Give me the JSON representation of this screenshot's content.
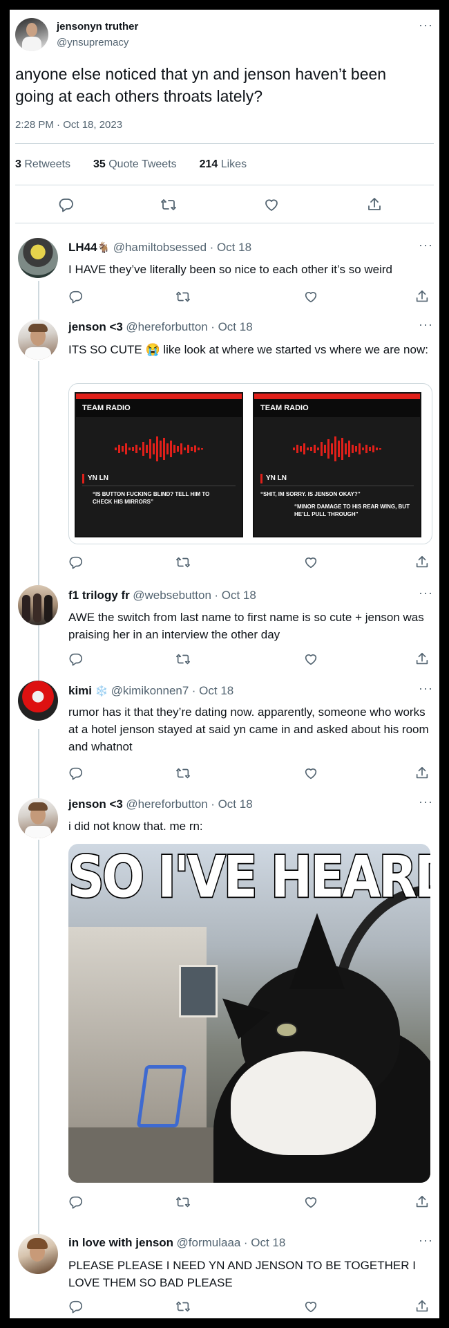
{
  "main_tweet": {
    "display_name": "jensonyn truther",
    "handle": "@ynsupremacy",
    "text": "anyone else noticed that yn and jenson haven’t been going at each others throats lately?",
    "timestamp": "2:28 PM · Oct 18, 2023",
    "stats": [
      {
        "count": "3",
        "label": "Retweets"
      },
      {
        "count": "35",
        "label": "Quote Tweets"
      },
      {
        "count": "214",
        "label": "Likes"
      }
    ]
  },
  "replies": [
    {
      "display_name": "LH44",
      "emoji": "🐐",
      "handle": "@hamiltobsessed",
      "date": "· Oct 18",
      "text": "I HAVE they’ve literally been so nice to each other it’s so weird"
    },
    {
      "display_name": "jenson <3",
      "handle": "@hereforbutton",
      "date": "· Oct 18",
      "text": "ITS SO CUTE 😭 like look at where we started vs where we are now:",
      "media": [
        {
          "header": "TEAM RADIO",
          "speaker": "YN LN",
          "quote": "“IS BUTTON FUCKING BLIND? TELL HIM TO CHECK HIS MIRRORS”",
          "reply": ""
        },
        {
          "header": "TEAM RADIO",
          "speaker": "YN LN",
          "quote": "“SHIT, IM SORRY. IS JENSON OKAY?”",
          "reply": "“MINOR DAMAGE TO HIS REAR WING, BUT HE’LL PULL THROUGH”"
        }
      ]
    },
    {
      "display_name": "f1 trilogy fr",
      "handle": "@websebutton",
      "date": "· Oct 18",
      "text": "AWE the switch from last name to first name is so cute + jenson was praising her in an interview the other day"
    },
    {
      "display_name": "kimi",
      "emoji": "❄️",
      "handle": "@kimikonnen7",
      "date": "· Oct 18",
      "text": "rumor has it that they’re dating now. apparently, someone who works at a hotel jenson stayed at said yn came in and asked about his room and whatnot"
    },
    {
      "display_name": "jenson <3",
      "handle": "@hereforbutton",
      "date": "· Oct 18",
      "text": "i did not know that. me rn:",
      "meme_caption": "SO I'VE HEARD"
    },
    {
      "display_name": "in love with jenson",
      "handle": "@formulaaa",
      "date": "· Oct 18",
      "text": "PLEASE PLEASE I NEED YN AND JENSON TO BE TOGETHER I LOVE THEM SO BAD PLEASE"
    }
  ],
  "more_glyph": "···",
  "colors": {
    "text": "#0f1419",
    "secondary": "#536471",
    "divider": "#cfd9de",
    "radio_red": "#e0201a",
    "radio_bg": "#1a1a1a"
  },
  "icons": [
    "reply-icon",
    "retweet-icon",
    "like-icon",
    "share-icon",
    "more-icon"
  ]
}
